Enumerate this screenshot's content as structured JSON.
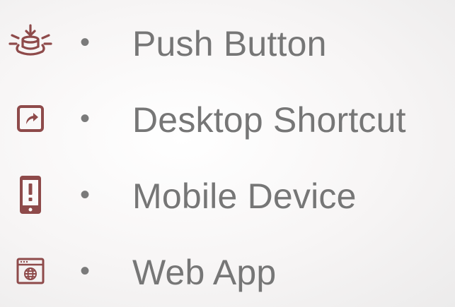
{
  "bullet_char": "•",
  "accent_color": "#8e4a4a",
  "text_color": "#767676",
  "items": [
    {
      "icon": "push-button-icon",
      "label": "Push Button"
    },
    {
      "icon": "desktop-shortcut-icon",
      "label": "Desktop Shortcut"
    },
    {
      "icon": "mobile-device-icon",
      "label": "Mobile Device"
    },
    {
      "icon": "web-app-icon",
      "label": "Web App"
    }
  ]
}
